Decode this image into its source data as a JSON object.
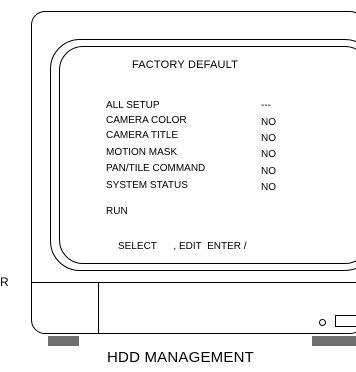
{
  "osd": {
    "title": "FACTORY DEFAULT",
    "items": [
      {
        "label": "ALL SETUP",
        "value": "---"
      },
      {
        "label": "CAMERA COLOR",
        "value": "NO"
      },
      {
        "label": "CAMERA TITLE",
        "value": "NO"
      },
      {
        "label": "MOTION  MASK",
        "value": "NO"
      },
      {
        "label": "PAN/TILE  COMMAND",
        "value": "NO"
      },
      {
        "label": "SYSTEM STATUS",
        "value": "NO"
      }
    ],
    "run_label": "RUN",
    "footer": "SELECT      , EDIT  ENTER /"
  },
  "side_letter": "R",
  "caption": "HDD MANAGEMENT"
}
